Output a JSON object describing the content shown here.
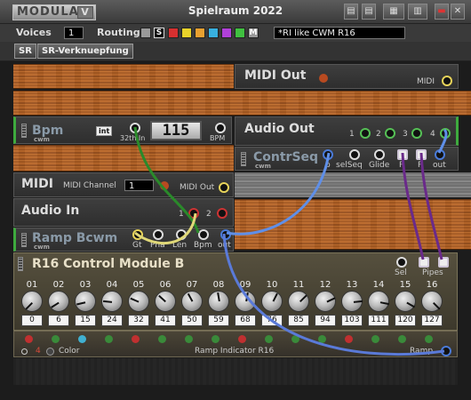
{
  "titlebar": {
    "logo": "MODULAR",
    "logo_mark": "V",
    "title": "Spielraum 2022"
  },
  "toolbar": {
    "voices_label": "Voices",
    "voices_value": "1",
    "routing_label": "Routing",
    "routing_letters": [
      "S",
      "M"
    ],
    "routing_colors": [
      "#9a9a9a",
      "#ffffff",
      "#d63030",
      "#e8d22a",
      "#e8a030",
      "#38b0e0",
      "#b040d8",
      "#40c040",
      "#9a9a9a"
    ],
    "patch_name": "*RI like CWM R16"
  },
  "subbar": {
    "sr_label": "SR",
    "sr_name": "SR-Verknuepfung"
  },
  "modules": {
    "midi_out": {
      "title": "MIDI Out",
      "port": "MIDI"
    },
    "bpm": {
      "title": "Bpm",
      "tag": "cwm",
      "int": "int",
      "port_left": "32th In",
      "value": "115",
      "port_right": "BPM"
    },
    "audio_out": {
      "title": "Audio Out",
      "ports": [
        "1",
        "2",
        "3",
        "4"
      ]
    },
    "contrseq": {
      "title": "ContrSeq",
      "tag": "cwm",
      "ports": [
        "p",
        "selSeq",
        "Glide",
        "P",
        "P",
        "out"
      ]
    },
    "midi": {
      "title": "MIDI",
      "channel_label": "MIDI Channel",
      "channel_value": "1",
      "port": "MIDI Out"
    },
    "audio_in": {
      "title": "Audio In",
      "ports": [
        "1",
        "2"
      ]
    },
    "ramp": {
      "title": "Ramp Bcwm",
      "tag": "cwm",
      "ports": [
        "Gt",
        "Pha",
        "Len",
        "Bpm",
        "out"
      ]
    },
    "r16": {
      "title": "R16 Control Module B",
      "sel": "Sel",
      "pipes": "Pipes",
      "knobs": [
        {
          "label": "01",
          "value": "0"
        },
        {
          "label": "02",
          "value": "6"
        },
        {
          "label": "03",
          "value": "15"
        },
        {
          "label": "04",
          "value": "24"
        },
        {
          "label": "05",
          "value": "32"
        },
        {
          "label": "06",
          "value": "41"
        },
        {
          "label": "07",
          "value": "50"
        },
        {
          "label": "08",
          "value": "59"
        },
        {
          "label": "09",
          "value": "68"
        },
        {
          "label": "10",
          "value": "76"
        },
        {
          "label": "11",
          "value": "85"
        },
        {
          "label": "12",
          "value": "94"
        },
        {
          "label": "13",
          "value": "103"
        },
        {
          "label": "14",
          "value": "111"
        },
        {
          "label": "15",
          "value": "120"
        },
        {
          "label": "16",
          "value": "127"
        }
      ]
    },
    "indicator": {
      "title": "Ramp Indicator R16",
      "count": "4",
      "color_label": "Color",
      "port": "Ramp",
      "led_colors": [
        "#c03030",
        "#3a8a3a",
        "#40b0d0",
        "#3a8a3a",
        "#c03030",
        "#3a8a3a",
        "#3a8a3a",
        "#3a8a3a",
        "#c03030",
        "#3a8a3a",
        "#3a8a3a",
        "#3a8a3a",
        "#c03030",
        "#3a8a3a",
        "#3a8a3a",
        "#3a8a3a"
      ]
    }
  }
}
